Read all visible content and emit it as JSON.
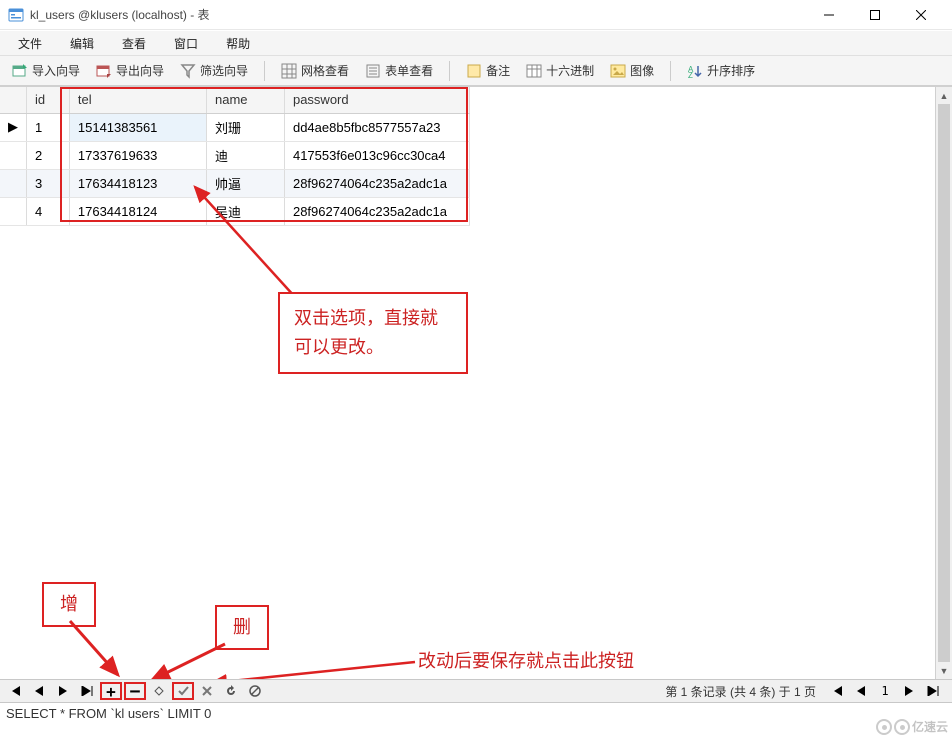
{
  "window": {
    "title": "kl_users @klusers (localhost) - 表"
  },
  "menu": {
    "file": "文件",
    "edit": "编辑",
    "view": "查看",
    "window": "窗口",
    "help": "帮助"
  },
  "toolbar": {
    "import": "导入向导",
    "export": "导出向导",
    "filter": "筛选向导",
    "gridview": "网格查看",
    "formview": "表单查看",
    "memo": "备注",
    "hex": "十六进制",
    "image": "图像",
    "sort": "升序排序"
  },
  "columns": {
    "id": "id",
    "tel": "tel",
    "name": "name",
    "password": "password"
  },
  "rows": [
    {
      "id": "1",
      "tel": "15141383561",
      "name": "刘珊",
      "password": "dd4ae8b5fbc8577557a23"
    },
    {
      "id": "2",
      "tel": "17337619633",
      "name": "   迪",
      "password": "417553f6e013c96cc30ca4"
    },
    {
      "id": "3",
      "tel": "17634418123",
      "name": "帅逼",
      "password": "28f96274064c235a2adc1a"
    },
    {
      "id": "4",
      "tel": "17634418124",
      "name": "吴迪",
      "password": "28f96274064c235a2adc1a"
    }
  ],
  "annotations": {
    "dblclick": "双击选项，直接就可以更改。",
    "add": "增",
    "del": "删",
    "save_hint": "改动后要保存就点击此按钮"
  },
  "nav": {
    "status": "第 1 条记录 (共 4 条) 于 1 页"
  },
  "sql": "SELECT * FROM `kl users` LIMIT 0",
  "watermark": "亿速云"
}
